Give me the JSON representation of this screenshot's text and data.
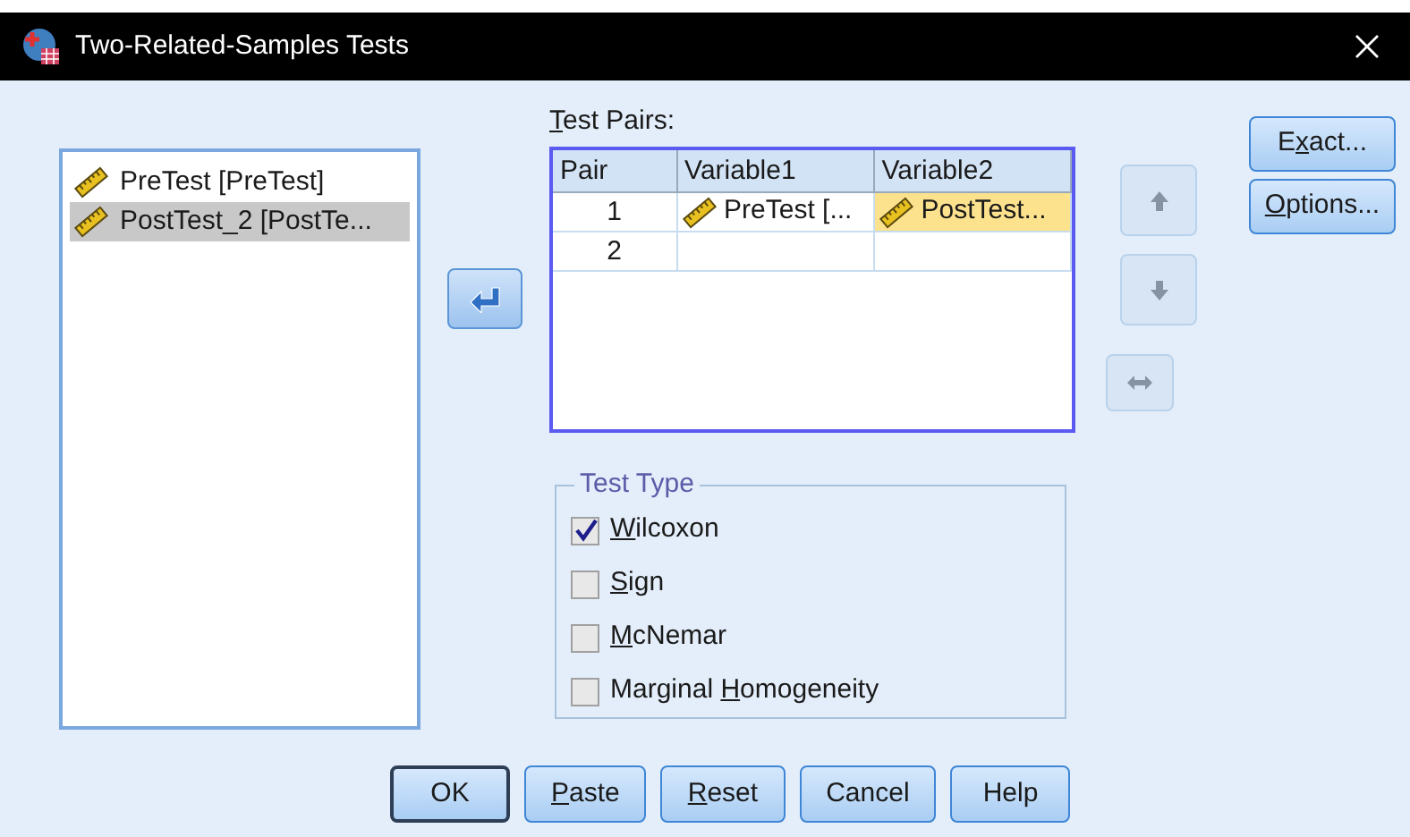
{
  "window": {
    "title": "Two-Related-Samples Tests"
  },
  "variables": [
    {
      "name": "PreTest [PreTest]",
      "selected": false
    },
    {
      "name": "PostTest_2 [PostTe...",
      "selected": true
    }
  ],
  "move_button": {
    "disabled": false
  },
  "test_pairs": {
    "label": {
      "key": "T",
      "post": "est Pairs:"
    },
    "columns": [
      "Pair",
      "Variable1",
      "Variable2"
    ],
    "rows": [
      [
        {
          "kind": "number",
          "text": "1"
        },
        {
          "kind": "variable",
          "text": "PreTest [...",
          "selected": false
        },
        {
          "kind": "variable",
          "text": "PostTest...",
          "selected": true
        }
      ],
      [
        {
          "kind": "number",
          "text": "2"
        },
        {
          "kind": "empty"
        },
        {
          "kind": "empty"
        }
      ]
    ]
  },
  "reorder_buttons": [
    {
      "kind": "up",
      "disabled": true
    },
    {
      "kind": "down",
      "disabled": true
    },
    {
      "kind": "swap",
      "disabled": true
    }
  ],
  "side_buttons": [
    {
      "label": {
        "pre": "E",
        "key": "x",
        "post": "act..."
      }
    },
    {
      "label": {
        "key": "O",
        "post": "ptions..."
      }
    }
  ],
  "test_type": {
    "title": "Test Type",
    "options": [
      {
        "label": {
          "key": "W",
          "post": "ilcoxon"
        },
        "checked": true
      },
      {
        "label": {
          "key": "S",
          "post": "ign"
        },
        "checked": false
      },
      {
        "label": {
          "key": "M",
          "post": "cNemar"
        },
        "checked": false
      },
      {
        "label": {
          "pre": "Marginal ",
          "key": "H",
          "post": "omogeneity"
        },
        "checked": false
      }
    ]
  },
  "buttons": [
    {
      "label": {
        "post": "OK"
      },
      "default": true
    },
    {
      "label": {
        "key": "P",
        "post": "aste"
      },
      "default": false
    },
    {
      "label": {
        "key": "R",
        "post": "eset"
      },
      "default": false
    },
    {
      "label": {
        "post": "Cancel"
      },
      "default": false
    },
    {
      "label": {
        "post": "Help"
      },
      "default": false
    }
  ]
}
